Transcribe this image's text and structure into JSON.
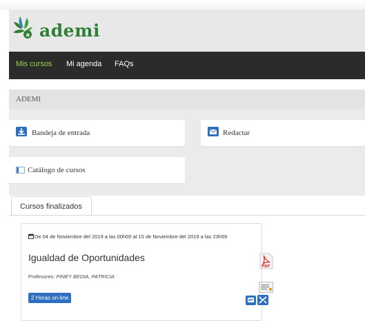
{
  "app": {
    "logo_text": "ademi"
  },
  "nav": {
    "items": [
      "Mis cursos",
      "Mi agenda",
      "FAQs"
    ]
  },
  "breadcrumb": "ADEMI",
  "shortcuts": {
    "inbox": "Bandeja de entrada",
    "compose": "Redactar",
    "catalog": "Catálogo de cursos"
  },
  "tabs": {
    "finished": "Cursos finalizados"
  },
  "course": {
    "dates": "De 04 de Noviembre del 2019 a las 00h00 al 15 de Noviembre del 2019 a las 23h59",
    "title": "Igualdad de Oportunidades",
    "teachers_label": "Profesores:",
    "teachers": "PINEY BEDIA, PATRICIA",
    "badge": "2 Horas on-line",
    "pdf_label": "PDF"
  },
  "colors": {
    "nav_bg": "#2b2b2b",
    "nav_active": "#9bd248",
    "logo_green": "#2f8036",
    "badge_blue": "#2e6fbf"
  }
}
